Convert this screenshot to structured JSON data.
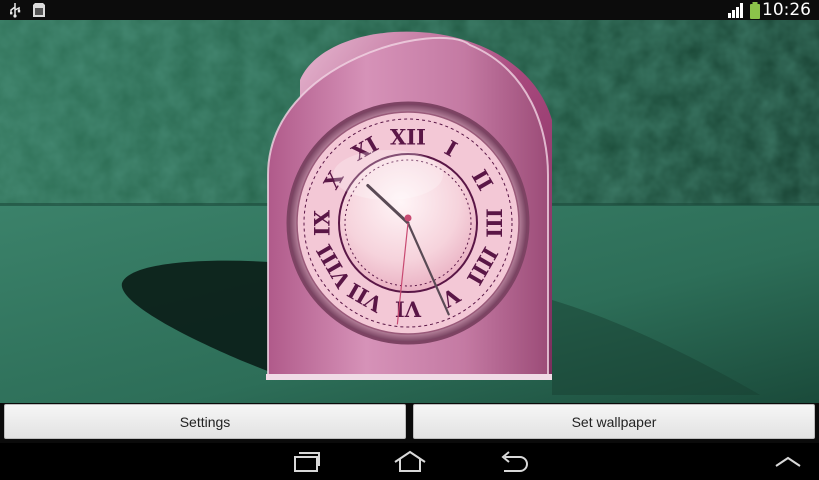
{
  "status_bar": {
    "time": "10:26",
    "left_icons": [
      "usb-icon",
      "sd-card-icon"
    ],
    "right_icons": [
      "signal-icon",
      "battery-icon"
    ],
    "battery_color": "#8bc34a"
  },
  "clock": {
    "numerals": [
      "XII",
      "I",
      "II",
      "III",
      "IIII",
      "V",
      "VI",
      "VII",
      "VIII",
      "IX",
      "X",
      "XI"
    ],
    "hour": 10,
    "minute": 26,
    "second": 31
  },
  "buttons": {
    "settings_label": "Settings",
    "set_wallpaper_label": "Set wallpaper"
  },
  "nav_bar": {
    "icons": [
      "recent-apps-icon",
      "home-icon",
      "back-icon",
      "chevron-up-icon"
    ]
  },
  "colors": {
    "wall": "#1f5a45",
    "table": "#2a6b56",
    "clock_case": "#c97aa5",
    "numeral": "#5a1646"
  }
}
